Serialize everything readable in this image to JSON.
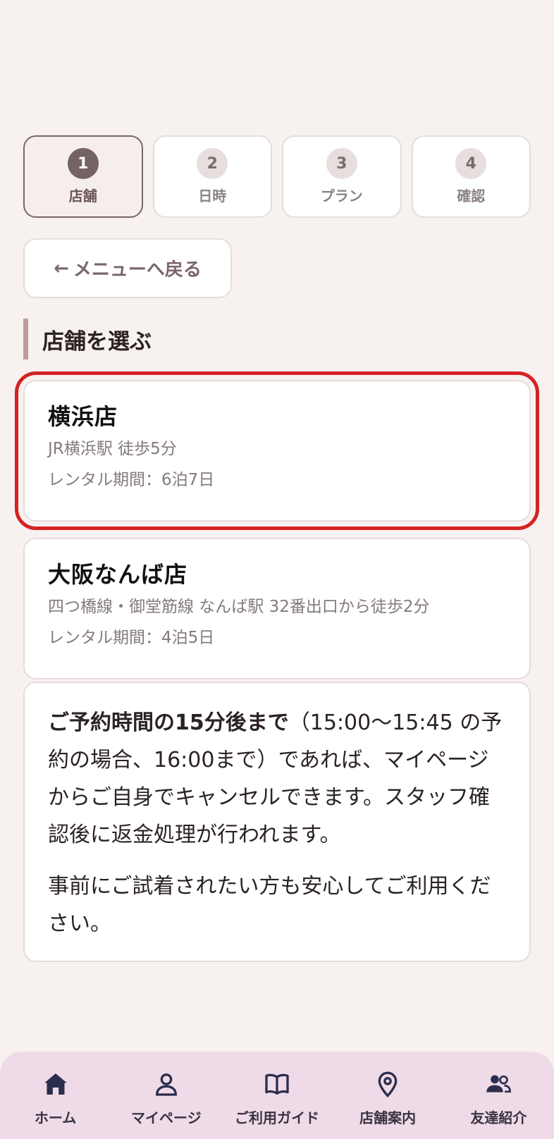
{
  "steps": [
    {
      "num": "1",
      "label": "店舗",
      "active": true
    },
    {
      "num": "2",
      "label": "日時",
      "active": false
    },
    {
      "num": "3",
      "label": "プラン",
      "active": false
    },
    {
      "num": "4",
      "label": "確認",
      "active": false
    }
  ],
  "back_button": {
    "arrow": "←",
    "label": "メニューへ戻る"
  },
  "section_title": "店舗を選ぶ",
  "stores": [
    {
      "name": "横浜店",
      "access": "JR横浜駅 徒歩5分",
      "period": "レンタル期間：6泊7日",
      "highlighted": true
    },
    {
      "name": "大阪なんば店",
      "access": "四つ橋線・御堂筋線 なんば駅 32番出口から徒歩2分",
      "period": "レンタル期間：4泊5日",
      "highlighted": false
    }
  ],
  "info": {
    "p1_bold": "ご予約時間の15分後まで",
    "p1_rest": "（15:00〜15:45 の予約の場合、16:00まで）であれば、マイページからご自身でキャンセルできます。スタッフ確認後に返金処理が行われます。",
    "p2": "事前にご試着されたい方も安心してご利用ください。"
  },
  "bottom_nav": [
    {
      "label": "ホーム",
      "icon": "home-icon"
    },
    {
      "label": "マイページ",
      "icon": "user-icon"
    },
    {
      "label": "ご利用ガイド",
      "icon": "book-icon"
    },
    {
      "label": "店舗案内",
      "icon": "map-pin-icon"
    },
    {
      "label": "友達紹介",
      "icon": "users-icon"
    }
  ],
  "colors": {
    "background": "#f7f1f0",
    "accent": "#746264",
    "highlight": "#d52222",
    "nav_background": "#eedbe7"
  }
}
